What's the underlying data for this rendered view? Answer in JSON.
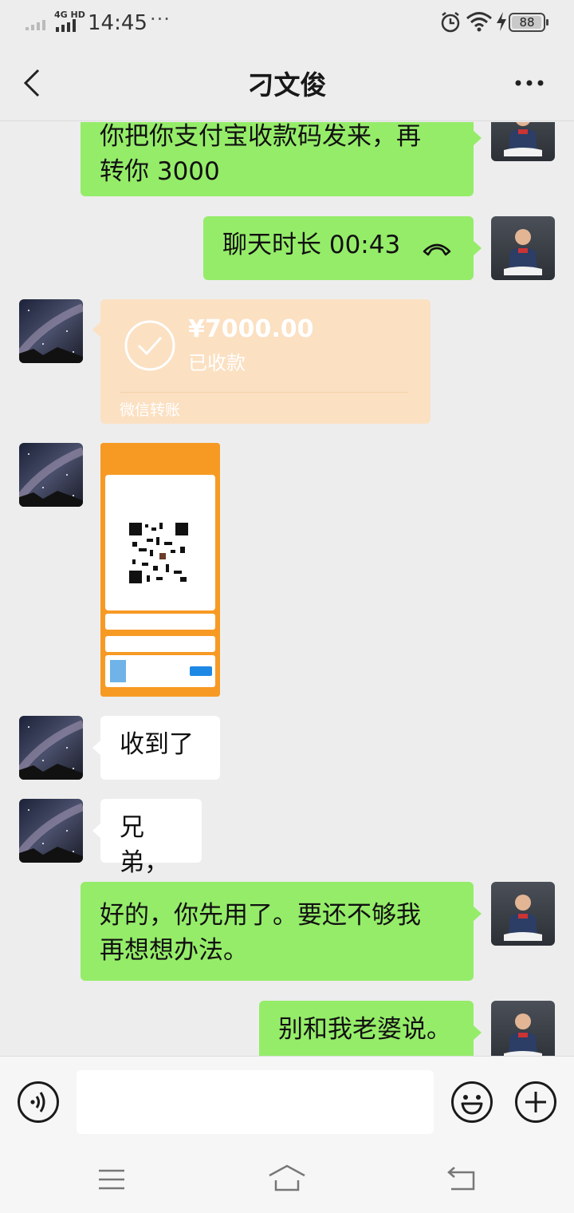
{
  "status_bar": {
    "network": "4G HD",
    "time": "14:45",
    "dots": "···",
    "battery": "88"
  },
  "header": {
    "title": "刁文俊"
  },
  "messages": [
    {
      "side": "self",
      "type": "text",
      "line1": "你把你支付宝收款码发来，再",
      "line2": "转你 3000"
    },
    {
      "side": "self",
      "type": "call",
      "text": "聊天时长 00:43"
    },
    {
      "side": "other",
      "type": "transfer",
      "amount": "¥7000.00",
      "status": "已收款",
      "footer": "微信转账"
    },
    {
      "side": "other",
      "type": "image",
      "description": "收款码 screenshot"
    },
    {
      "side": "other",
      "type": "text",
      "text": "收到了"
    },
    {
      "side": "other",
      "type": "text",
      "text": "兄弟，"
    },
    {
      "side": "self",
      "type": "text",
      "line1": "好的，你先用了。要还不够我",
      "line2": "再想想办法。"
    },
    {
      "side": "self",
      "type": "text",
      "text": "别和我老婆说。"
    }
  ],
  "input": {
    "value": "",
    "placeholder": ""
  },
  "colors": {
    "self_bubble": "#95ec69",
    "other_bubble": "#ffffff",
    "transfer_bg": "#fbe0c2",
    "background": "#ededed"
  }
}
